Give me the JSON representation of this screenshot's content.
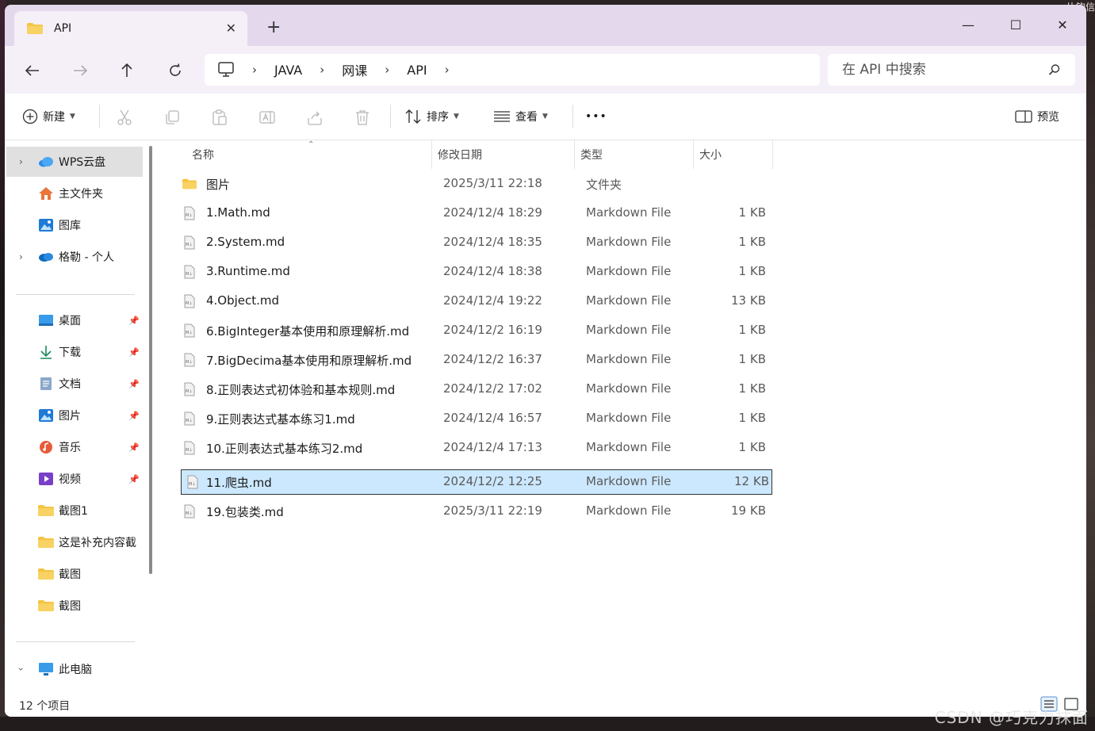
{
  "window": {
    "tab_title": "API",
    "new_tab": "+",
    "minimize": "—",
    "maximize": "☐",
    "close": "✕"
  },
  "nav": {
    "back": "←",
    "forward": "→",
    "up": "↑",
    "refresh": "⟳",
    "breadcrumb": [
      "JAVA",
      "网课",
      "API"
    ],
    "search_placeholder": "在 API 中搜索"
  },
  "toolbar": {
    "new_label": "新建",
    "sort_label": "排序",
    "view_label": "查看",
    "more": "•••",
    "preview_label": "预览"
  },
  "sidebar": {
    "items": [
      {
        "label": "WPS云盘",
        "icon": "cloud-icon",
        "expandable": true
      },
      {
        "label": "主文件夹",
        "icon": "home-icon"
      },
      {
        "label": "图库",
        "icon": "gallery-icon"
      },
      {
        "label": "格勒 - 个人",
        "icon": "onedrive-icon",
        "expandable": true
      }
    ],
    "pinned": [
      {
        "label": "桌面",
        "icon": "desktop-icon",
        "pinned": true
      },
      {
        "label": "下载",
        "icon": "download-icon",
        "pinned": true
      },
      {
        "label": "文档",
        "icon": "document-icon",
        "pinned": true
      },
      {
        "label": "图片",
        "icon": "picture-icon",
        "pinned": true
      },
      {
        "label": "音乐",
        "icon": "music-icon",
        "pinned": true
      },
      {
        "label": "视频",
        "icon": "video-icon",
        "pinned": true
      },
      {
        "label": "截图1",
        "icon": "folder-icon"
      },
      {
        "label": "这是补充内容截",
        "icon": "folder-icon"
      },
      {
        "label": "截图",
        "icon": "folder-icon"
      },
      {
        "label": "截图",
        "icon": "folder-icon"
      }
    ],
    "this_pc": {
      "label": "此电脑",
      "icon": "computer-icon",
      "expanded": true
    }
  },
  "columns": {
    "name": "名称",
    "date": "修改日期",
    "type": "类型",
    "size": "大小"
  },
  "files": [
    {
      "name": "图片",
      "date": "2025/3/11 22:18",
      "type": "文件夹",
      "size": "",
      "kind": "folder"
    },
    {
      "name": "1.Math.md",
      "date": "2024/12/4 18:29",
      "type": "Markdown File",
      "size": "1 KB",
      "kind": "md"
    },
    {
      "name": "2.System.md",
      "date": "2024/12/4 18:35",
      "type": "Markdown File",
      "size": "1 KB",
      "kind": "md"
    },
    {
      "name": "3.Runtime.md",
      "date": "2024/12/4 18:38",
      "type": "Markdown File",
      "size": "1 KB",
      "kind": "md"
    },
    {
      "name": "4.Object.md",
      "date": "2024/12/4 19:22",
      "type": "Markdown File",
      "size": "13 KB",
      "kind": "md"
    },
    {
      "name": "6.BigInteger基本使用和原理解析.md",
      "date": "2024/12/2 16:19",
      "type": "Markdown File",
      "size": "1 KB",
      "kind": "md"
    },
    {
      "name": "7.BigDecima基本使用和原理解析.md",
      "date": "2024/12/2 16:37",
      "type": "Markdown File",
      "size": "1 KB",
      "kind": "md"
    },
    {
      "name": "8.正则表达式初体验和基本规则.md",
      "date": "2024/12/2 17:02",
      "type": "Markdown File",
      "size": "1 KB",
      "kind": "md"
    },
    {
      "name": "9.正则表达式基本练习1.md",
      "date": "2024/12/4 16:57",
      "type": "Markdown File",
      "size": "1 KB",
      "kind": "md"
    },
    {
      "name": "10.正则表达式基本练习2.md",
      "date": "2024/12/4 17:13",
      "type": "Markdown File",
      "size": "1 KB",
      "kind": "md"
    },
    {
      "name": "11.爬虫.md",
      "date": "2024/12/2 12:25",
      "type": "Markdown File",
      "size": "12 KB",
      "kind": "md",
      "selected": true
    },
    {
      "name": "19.包装类.md",
      "date": "2025/3/11 22:19",
      "type": "Markdown File",
      "size": "19 KB",
      "kind": "md"
    }
  ],
  "status": {
    "item_count": "12 个项目"
  },
  "overlay": {
    "corner": "片钩信",
    "watermark": "CSDN @巧克力抹面"
  },
  "colors": {
    "titlebar": "#e3d8ec",
    "navbar": "#f5f0f8",
    "selection": "#cce8ff",
    "folder": "#f4c443",
    "accent": "#0a64c8"
  }
}
